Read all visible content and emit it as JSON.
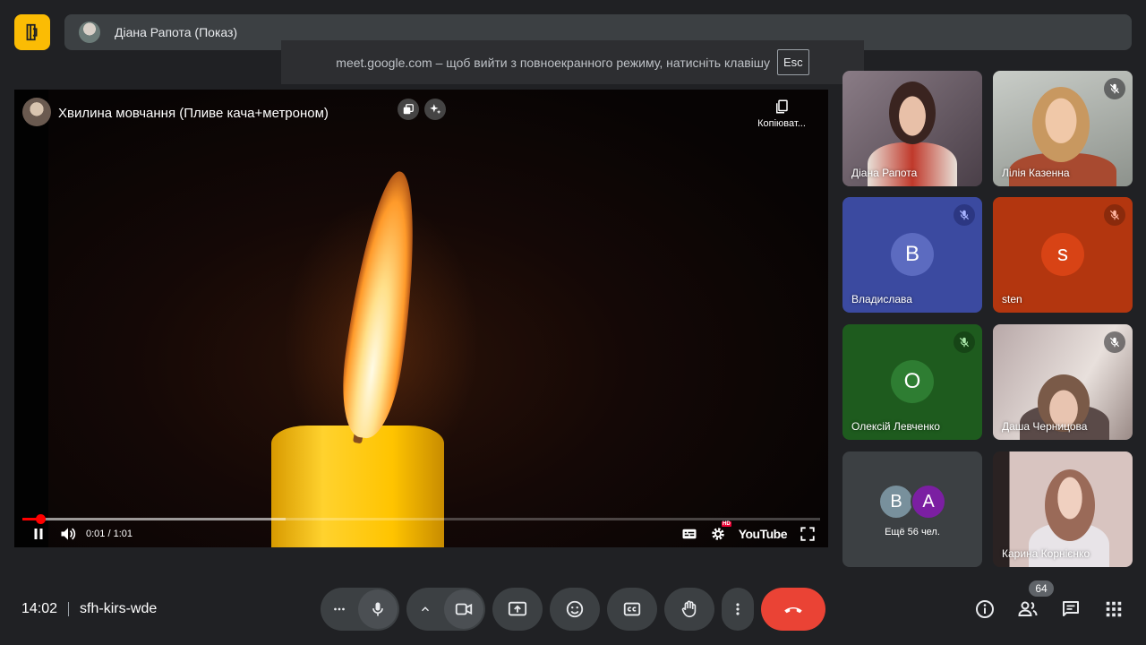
{
  "presenter_bar": {
    "name": "Діана Рапота (Показ)"
  },
  "fullscreen_toast": {
    "message": "meet.google.com – щоб вийти з повноекранного режиму, натисніть клавішу",
    "key": "Esc"
  },
  "video": {
    "title": "Хвилина мовчання (Пливе кача+метроном)",
    "copy_label": "Копіюват...",
    "time": "0:01 / 1:01",
    "progress_fraction": 0.023,
    "buffer_fraction": 0.33,
    "youtube_label": "YouTube",
    "hd_badge": "HD"
  },
  "participants": [
    {
      "name": "Діана Рапота",
      "muted": false,
      "kind": "photo"
    },
    {
      "name": "Лілія Казенна",
      "muted": true,
      "kind": "photo"
    },
    {
      "name": "Владислава",
      "muted": true,
      "kind": "avatar",
      "initial": "В",
      "bg": "#3b4aa0",
      "avatar_bg": "#5c6bc0"
    },
    {
      "name": "sten",
      "muted": true,
      "kind": "avatar",
      "initial": "s",
      "bg": "#b3360f",
      "avatar_bg": "#d84315"
    },
    {
      "name": "Олексій Левченко",
      "muted": true,
      "kind": "avatar",
      "initial": "О",
      "bg": "#1e5b1e",
      "avatar_bg": "#2e7d32"
    },
    {
      "name": "Даша Черницова",
      "muted": true,
      "kind": "photo"
    },
    {
      "name": "Карина Корнієнко",
      "muted": false,
      "kind": "photo"
    }
  ],
  "more_tile": {
    "avatars": [
      {
        "initial": "В",
        "bg": "#78909c"
      },
      {
        "initial": "А",
        "bg": "#7b1fa2"
      }
    ],
    "label": "Ещё 56 чел."
  },
  "bottom_bar": {
    "clock": "14:02",
    "meeting_code": "sfh-kirs-wde",
    "people_count": "64"
  },
  "colors": {
    "background": "#202124",
    "surface": "#3c4043",
    "end_call": "#ea4335",
    "logo": "#fbbc04"
  }
}
